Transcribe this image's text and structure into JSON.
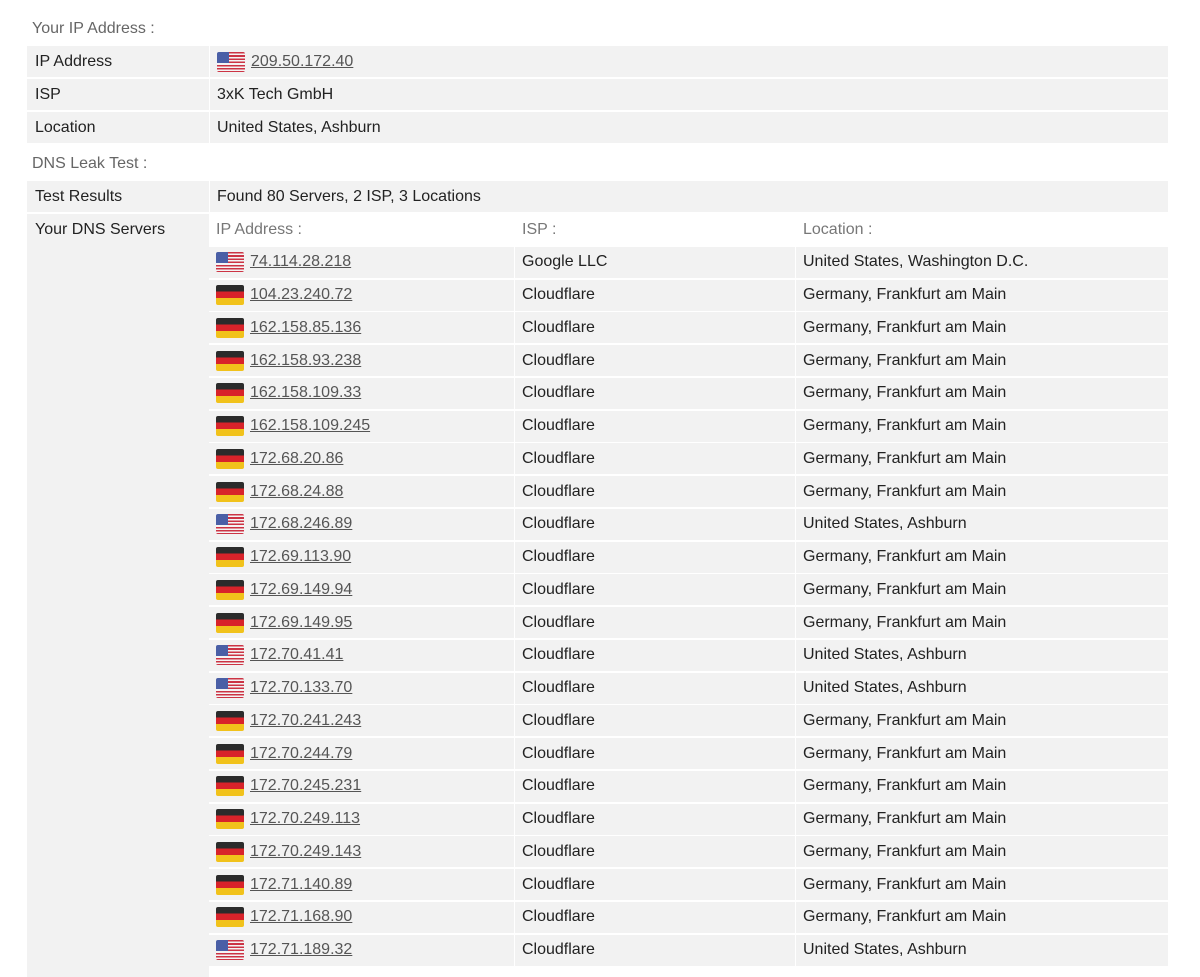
{
  "ip_section": {
    "heading": "Your IP Address :",
    "rows": [
      {
        "label": "IP Address",
        "value": "209.50.172.40",
        "flag": "us-flag-icon"
      },
      {
        "label": "ISP",
        "value": "3xK Tech GmbH"
      },
      {
        "label": "Location",
        "value": "United States, Ashburn"
      }
    ]
  },
  "dns_section": {
    "heading": "DNS Leak Test :",
    "test_results_label": "Test Results",
    "test_results_value": "Found 80 Servers, 2 ISP, 3 Locations",
    "servers_label": "Your DNS Servers",
    "columns": [
      "IP Address :",
      "ISP :",
      "Location :"
    ],
    "servers": [
      {
        "ip": "74.114.28.218",
        "isp": "Google LLC",
        "location": "United States, Washington D.C.",
        "flag": "us"
      },
      {
        "ip": "104.23.240.72",
        "isp": "Cloudflare",
        "location": "Germany, Frankfurt am Main",
        "flag": "de"
      },
      {
        "ip": "162.158.85.136",
        "isp": "Cloudflare",
        "location": "Germany, Frankfurt am Main",
        "flag": "de"
      },
      {
        "ip": "162.158.93.238",
        "isp": "Cloudflare",
        "location": "Germany, Frankfurt am Main",
        "flag": "de"
      },
      {
        "ip": "162.158.109.33",
        "isp": "Cloudflare",
        "location": "Germany, Frankfurt am Main",
        "flag": "de"
      },
      {
        "ip": "162.158.109.245",
        "isp": "Cloudflare",
        "location": "Germany, Frankfurt am Main",
        "flag": "de"
      },
      {
        "ip": "172.68.20.86",
        "isp": "Cloudflare",
        "location": "Germany, Frankfurt am Main",
        "flag": "de"
      },
      {
        "ip": "172.68.24.88",
        "isp": "Cloudflare",
        "location": "Germany, Frankfurt am Main",
        "flag": "de"
      },
      {
        "ip": "172.68.246.89",
        "isp": "Cloudflare",
        "location": "United States, Ashburn",
        "flag": "us"
      },
      {
        "ip": "172.69.113.90",
        "isp": "Cloudflare",
        "location": "Germany, Frankfurt am Main",
        "flag": "de"
      },
      {
        "ip": "172.69.149.94",
        "isp": "Cloudflare",
        "location": "Germany, Frankfurt am Main",
        "flag": "de"
      },
      {
        "ip": "172.69.149.95",
        "isp": "Cloudflare",
        "location": "Germany, Frankfurt am Main",
        "flag": "de"
      },
      {
        "ip": "172.70.41.41",
        "isp": "Cloudflare",
        "location": "United States, Ashburn",
        "flag": "us"
      },
      {
        "ip": "172.70.133.70",
        "isp": "Cloudflare",
        "location": "United States, Ashburn",
        "flag": "us"
      },
      {
        "ip": "172.70.241.243",
        "isp": "Cloudflare",
        "location": "Germany, Frankfurt am Main",
        "flag": "de"
      },
      {
        "ip": "172.70.244.79",
        "isp": "Cloudflare",
        "location": "Germany, Frankfurt am Main",
        "flag": "de"
      },
      {
        "ip": "172.70.245.231",
        "isp": "Cloudflare",
        "location": "Germany, Frankfurt am Main",
        "flag": "de"
      },
      {
        "ip": "172.70.249.113",
        "isp": "Cloudflare",
        "location": "Germany, Frankfurt am Main",
        "flag": "de"
      },
      {
        "ip": "172.70.249.143",
        "isp": "Cloudflare",
        "location": "Germany, Frankfurt am Main",
        "flag": "de"
      },
      {
        "ip": "172.71.140.89",
        "isp": "Cloudflare",
        "location": "Germany, Frankfurt am Main",
        "flag": "de"
      },
      {
        "ip": "172.71.168.90",
        "isp": "Cloudflare",
        "location": "Germany, Frankfurt am Main",
        "flag": "de"
      },
      {
        "ip": "172.71.189.32",
        "isp": "Cloudflare",
        "location": "United States, Ashburn",
        "flag": "us"
      }
    ]
  }
}
